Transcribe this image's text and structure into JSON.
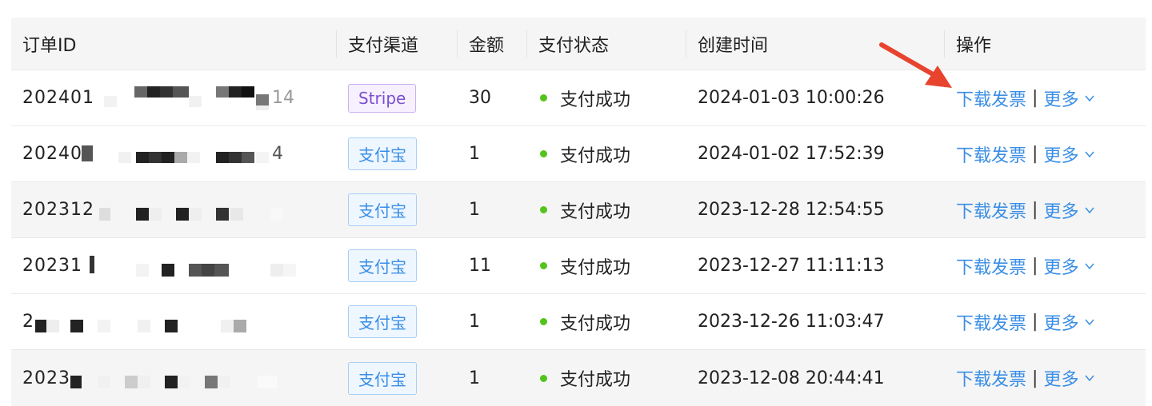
{
  "headers": {
    "order_id": "订单ID",
    "channel": "支付渠道",
    "amount": "金额",
    "status": "支付状态",
    "created": "创建时间",
    "actions": "操作"
  },
  "actions": {
    "invoice": "下载发票",
    "separator": "|",
    "more": "更多"
  },
  "rows": [
    {
      "id_prefix": "202401",
      "id_suffix": "14",
      "channel": "Stripe",
      "channel_type": "stripe",
      "amount": "30",
      "status": "支付成功",
      "created": "2024-01-03 10:00:26"
    },
    {
      "id_prefix": "20240",
      "id_suffix": "4",
      "channel": "支付宝",
      "channel_type": "alipay",
      "amount": "1",
      "status": "支付成功",
      "created": "2024-01-02 17:52:39"
    },
    {
      "id_prefix": "202312",
      "id_suffix": "",
      "channel": "支付宝",
      "channel_type": "alipay",
      "amount": "1",
      "status": "支付成功",
      "created": "2023-12-28 12:54:55"
    },
    {
      "id_prefix": "20231",
      "id_suffix": "",
      "channel": "支付宝",
      "channel_type": "alipay",
      "amount": "11",
      "status": "支付成功",
      "created": "2023-12-27 11:11:13"
    },
    {
      "id_prefix": "2",
      "id_suffix": "",
      "channel": "支付宝",
      "channel_type": "alipay",
      "amount": "1",
      "status": "支付成功",
      "created": "2023-12-26 11:03:47"
    },
    {
      "id_prefix": "2023",
      "id_suffix": "",
      "channel": "支付宝",
      "channel_type": "alipay",
      "amount": "1",
      "status": "支付成功",
      "created": "2023-12-08 20:44:41"
    }
  ],
  "colors": {
    "link": "#3a8ee6",
    "success_dot": "#52c41a",
    "arrow": "#e8432e",
    "stripe_tag": "#7b4fd1",
    "alipay_tag": "#3a8ee6"
  },
  "icons": {
    "status": "green-dot-icon",
    "more": "chevron-down-icon",
    "annotation": "red-arrow-icon"
  }
}
